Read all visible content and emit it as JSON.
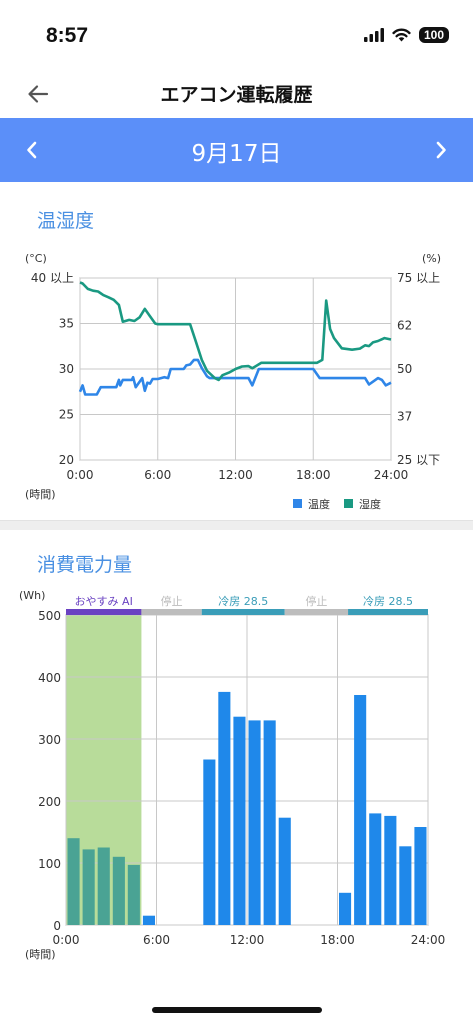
{
  "status_bar": {
    "time": "8:57",
    "battery": "100"
  },
  "header": {
    "title": "エアコン運転履歴",
    "back_icon": "arrow-left-icon"
  },
  "date_nav": {
    "date": "9月17日",
    "prev_icon": "chevron-left-icon",
    "next_icon": "chevron-right-icon",
    "background": "#5b8ff9"
  },
  "temp_humidity": {
    "title": "温湿度",
    "left_unit": "(°C)",
    "right_unit": "(%)",
    "x_unit": "(時間)",
    "legend": {
      "temperature": "温度",
      "humidity": "湿度"
    },
    "colors": {
      "temperature": "#2f86e8",
      "humidity": "#1a9982"
    }
  },
  "power": {
    "title": "消費電力量",
    "y_unit": "(Wh)",
    "x_unit": "(時間)",
    "modes": [
      {
        "label": "おやすみ AI",
        "start": 0,
        "end": 5,
        "color": "#6a42c2"
      },
      {
        "label": "停止",
        "start": 5,
        "end": 9,
        "color": "#bdbdbd"
      },
      {
        "label": "冷房 28.5",
        "start": 9,
        "end": 14.5,
        "color": "#3a9db8"
      },
      {
        "label": "停止",
        "start": 14.5,
        "end": 18.7,
        "color": "#bdbdbd"
      },
      {
        "label": "冷房 28.5",
        "start": 18.7,
        "end": 24,
        "color": "#3a9db8"
      }
    ],
    "sleep_region": {
      "start": 0,
      "end": 5,
      "color": "#b8dc9a"
    },
    "colors": {
      "bar": "#1f88ea",
      "bar_in_sleep": "#4aa394"
    }
  },
  "chart_data": [
    {
      "type": "line",
      "title": "温湿度",
      "xlabel": "(時間)",
      "x_ticks": [
        "0:00",
        "6:00",
        "12:00",
        "18:00",
        "24:00"
      ],
      "xlim": [
        0,
        24
      ],
      "y_left": {
        "label": "(°C)",
        "ticks": [
          "40 以上",
          "35",
          "30",
          "25",
          "20"
        ],
        "tick_values": [
          40,
          35,
          30,
          25,
          20
        ],
        "lim": [
          20,
          40
        ]
      },
      "y_right": {
        "label": "(%)",
        "ticks": [
          "75 以上",
          "62",
          "50",
          "37",
          "25 以下"
        ],
        "tick_values": [
          75,
          62,
          50,
          37,
          25
        ],
        "lim": [
          25,
          75
        ]
      },
      "grid": true,
      "legend_position": "bottom-right",
      "series": [
        {
          "name": "温度",
          "axis": "left",
          "x": [
            0,
            0.2,
            0.4,
            1.3,
            1.6,
            1.8,
            2.8,
            3.0,
            3.1,
            3.3,
            4.0,
            4.1,
            4.3,
            4.8,
            5.0,
            5.2,
            5.4,
            5.6,
            6.0,
            6.5,
            6.8,
            7.0,
            8.0,
            8.2,
            8.5,
            8.8,
            9.1,
            9.4,
            9.8,
            10,
            11,
            12,
            13,
            13.3,
            13.8,
            14,
            15,
            16,
            17,
            18,
            18.5,
            19,
            20,
            21,
            21.5,
            22,
            22.3,
            23,
            23.3,
            23.6,
            24
          ],
          "y": [
            27.5,
            28.2,
            27.2,
            27.2,
            28,
            28,
            28,
            28.8,
            28.2,
            28.8,
            28.8,
            29.1,
            28,
            29,
            27.6,
            28.5,
            28.4,
            28.9,
            28.9,
            29.1,
            29,
            30,
            30,
            30.4,
            30.5,
            31,
            31,
            30.1,
            29.2,
            29,
            29,
            29,
            29,
            28.2,
            30,
            30,
            30,
            30,
            30,
            30,
            29,
            29,
            29,
            29,
            29,
            29,
            28.3,
            29,
            28.8,
            28.2,
            28.5
          ]
        },
        {
          "name": "湿度",
          "axis": "right",
          "x": [
            0,
            0.2,
            0.6,
            1.0,
            1.4,
            1.8,
            2.2,
            2.6,
            3.0,
            3.3,
            3.8,
            4.2,
            4.6,
            5.0,
            5.4,
            5.8,
            6.0,
            7.0,
            8.0,
            8.5,
            8.9,
            9.4,
            9.8,
            10.4,
            10.7,
            11.0,
            11.5,
            12.0,
            12.5,
            13.0,
            13.3,
            14,
            16,
            18,
            18.3,
            18.7,
            19.0,
            19.3,
            19.6,
            20.2,
            21.0,
            21.6,
            22.0,
            22.3,
            22.6,
            23.0,
            23.5,
            24
          ],
          "y": [
            73.8,
            73.5,
            72,
            71.5,
            71.3,
            70.3,
            69.7,
            69.0,
            67.6,
            63,
            63.5,
            63.2,
            64.2,
            66.5,
            64.5,
            62.5,
            62.3,
            62.3,
            62.3,
            62.3,
            58,
            52.5,
            49.5,
            47.5,
            47,
            48.3,
            49,
            50,
            50.7,
            50.8,
            50.2,
            51.7,
            51.7,
            51.7,
            51.7,
            52.5,
            68.8,
            61,
            58.5,
            55.7,
            55.3,
            55.6,
            56.5,
            56.3,
            57.3,
            57.7,
            58.5,
            58.1
          ]
        }
      ]
    },
    {
      "type": "bar",
      "title": "消費電力量",
      "xlabel": "(時間)",
      "ylabel": "(Wh)",
      "x_ticks": [
        "0:00",
        "6:00",
        "12:00",
        "18:00",
        "24:00"
      ],
      "y_ticks": [
        0,
        100,
        200,
        300,
        400,
        500
      ],
      "ylim": [
        0,
        500
      ],
      "xlim": [
        0,
        24
      ],
      "grid": true,
      "hours": [
        0,
        1,
        2,
        3,
        4,
        5,
        6,
        7,
        8,
        9,
        10,
        11,
        12,
        13,
        14,
        15,
        16,
        17,
        18,
        19,
        20,
        21,
        22,
        23
      ],
      "values": [
        140,
        122,
        125,
        110,
        97,
        15,
        0,
        0,
        0,
        267,
        376,
        336,
        330,
        330,
        173,
        0,
        0,
        0,
        52,
        371,
        180,
        176,
        127,
        158
      ]
    }
  ]
}
